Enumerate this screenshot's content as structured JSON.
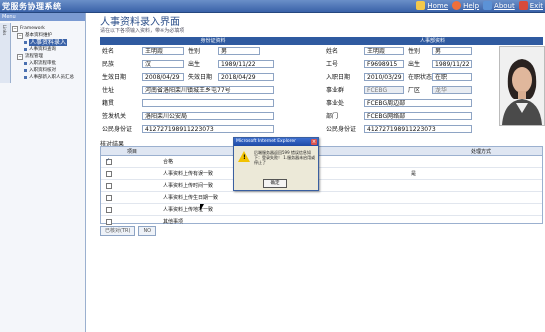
{
  "app": {
    "title": "党服务协理系统"
  },
  "toplinks": [
    {
      "label": "Home",
      "icon": "home-icon"
    },
    {
      "label": "Help",
      "icon": "help-icon"
    },
    {
      "label": "About",
      "icon": "about-icon"
    },
    {
      "label": "Exit",
      "icon": "exit-icon"
    }
  ],
  "sidebar": {
    "header": "Menu",
    "vtab": "Links",
    "tree": [
      {
        "label": "Framework",
        "kind": "root"
      },
      {
        "label": "基本资料维护",
        "kind": "folder"
      },
      {
        "label": "人事资料录入",
        "kind": "leaf",
        "selected": true
      },
      {
        "label": "人事资料查询",
        "kind": "leaf"
      },
      {
        "label": "流程管理",
        "kind": "folder"
      },
      {
        "label": "入职流程审批",
        "kind": "leaf"
      },
      {
        "label": "入职资料核对",
        "kind": "leaf"
      },
      {
        "label": "人事部新入职人员汇总",
        "kind": "leaf"
      }
    ]
  },
  "main": {
    "title": "人事资料录入界面",
    "subtitle": "请在以下各项输入资料，带※为必填项",
    "left_panel_title": "身份证资料",
    "right_panel_title": "人事部资料",
    "left": {
      "name_label": "姓名",
      "name": "王明霞",
      "gender_label": "性别",
      "gender": "男",
      "ethnic_label": "民族",
      "ethnic": "汉",
      "birth_label": "出生",
      "birth": "1989/11/22",
      "issue_label": "生效日期",
      "issue": "2008/04/29",
      "expire_label": "失效日期",
      "expire": "2018/04/29",
      "address_label": "住址",
      "address": "河南省洛阳栾川镇城王乡屯77号",
      "id_label": "籍贯",
      "id": "",
      "authority_label": "签发机关",
      "authority": "洛阳栾川公安局",
      "idcard_label": "公民身份证",
      "idcard": "412727198911223073"
    },
    "right": {
      "name_label": "姓名",
      "name": "王明霞",
      "gender_label": "性别",
      "gender": "男",
      "empno_label": "工号",
      "empno": "F9698915",
      "birth_label": "出生",
      "birth": "1989/11/22",
      "join_label": "入职日期",
      "join": "2010/03/29",
      "status_label": "在职状态",
      "status": "在职",
      "group_label": "事业群",
      "group": "FCEBG",
      "factory_label": "厂区",
      "factory": "龙华",
      "bu_label": "事业处",
      "bu": "FCEBG周边部",
      "dept_label": "部门",
      "dept": "FCEBG网络部",
      "idcard_label": "公民身份证",
      "idcard": "412727198911223073"
    },
    "checks": {
      "title": "核对结果",
      "col1": "项目",
      "col2": "处理方式",
      "rows": [
        {
          "checked": true,
          "name": "合格",
          "method": ""
        },
        {
          "checked": false,
          "name": "人事资料上传有误一致",
          "method": "是"
        },
        {
          "checked": false,
          "name": "人事资料上传时间一致",
          "method": ""
        },
        {
          "checked": false,
          "name": "人事资料上传生日期一致",
          "method": ""
        },
        {
          "checked": false,
          "name": "人事资料上传地址一致",
          "method": ""
        },
        {
          "checked": false,
          "name": "其他事项",
          "method": ""
        }
      ]
    },
    "buttons": {
      "submit": "已核对(TR)",
      "cancel": "NO"
    }
  },
  "dialog": {
    "title": "Microsoft Internet Explorer",
    "message": "后端服务器返回599 错误信息如下：登录失败！ 1.服务器未启用或停止了",
    "ok": "确定"
  },
  "colors": {
    "accent": "#2f5aa0",
    "topbar": "#3a62a8",
    "warning": "#f2c200"
  }
}
